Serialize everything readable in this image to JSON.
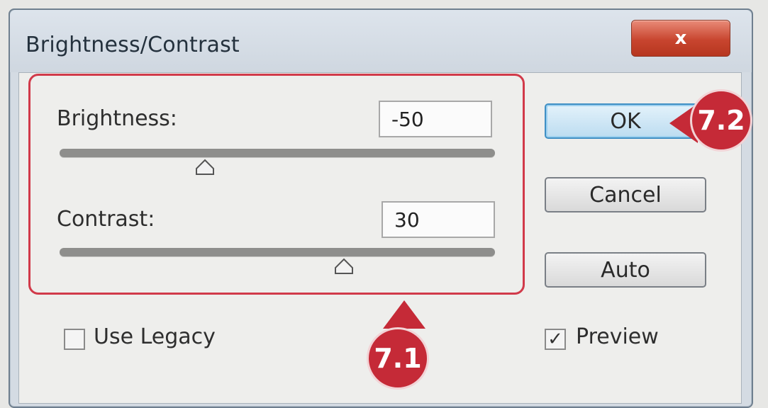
{
  "dialog": {
    "title": "Brightness/Contrast",
    "close_label": "x"
  },
  "brightness": {
    "label": "Brightness:",
    "value": "-50"
  },
  "contrast": {
    "label": "Contrast:",
    "value": "30"
  },
  "buttons": {
    "ok": "OK",
    "cancel": "Cancel",
    "auto": "Auto"
  },
  "options": {
    "use_legacy": {
      "label": "Use Legacy",
      "checked": false
    },
    "preview": {
      "label": "Preview",
      "checked": true,
      "mark": "✓"
    }
  },
  "callouts": {
    "group": "7.1",
    "ok": "7.2"
  },
  "colors": {
    "callout": "#c52a37",
    "ok_highlight": "#3f8fc4"
  }
}
